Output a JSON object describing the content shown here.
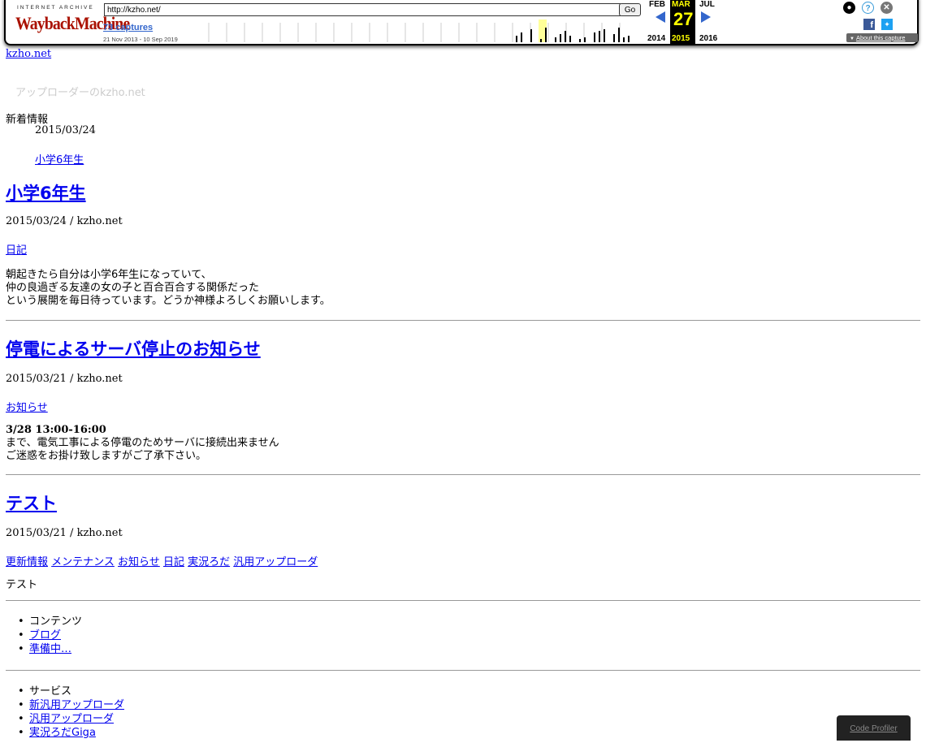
{
  "wayback": {
    "ia_text": "INTERNET ARCHIVE",
    "logo_text": "WaybackMachine",
    "url": "http://kzho.net/",
    "go_label": "Go",
    "captures_label": "73 captures",
    "capture_dates": "21 Nov 2013 - 10 Sep 2019",
    "prev_month": "FEB",
    "current_month": "MAR",
    "next_month": "JUL",
    "current_day": "27",
    "prev_year": "2014",
    "current_year": "2015",
    "next_year": "2016",
    "about_label": "About this capture",
    "user_icon": "person-icon",
    "help_glyph": "?",
    "close_glyph": "✕",
    "facebook_glyph": "f",
    "twitter_glyph": "t"
  },
  "site": {
    "top_link": "kzho.net",
    "tagline": "アップローダーのkzho.net",
    "news_heading": "新着情報",
    "news_date": "2015/03/24",
    "news_link": "小学6年生"
  },
  "posts": [
    {
      "title": "小学6年生",
      "meta": "2015/03/24 / kzho.net",
      "categories": [
        "日記"
      ],
      "body": [
        "朝起きたら自分は小学6年生になっていて、",
        "仲の良過ぎる友達の女の子と百合百合する関係だった",
        "という展開を毎日待っています。どうか神様よろしくお願いします。"
      ]
    },
    {
      "title": "停電によるサーバ停止のお知らせ",
      "meta": "2015/03/21 / kzho.net",
      "categories": [
        "お知らせ"
      ],
      "bold_line": "3/28 13:00-16:00",
      "body": [
        "まで、電気工事による停電のためサーバに接続出来ません",
        "ご迷惑をお掛け致しますがご了承下さい。"
      ]
    },
    {
      "title": "テスト",
      "meta": "2015/03/21 / kzho.net",
      "categories": [
        "更新情報",
        "メンテナンス",
        "お知らせ",
        "日記",
        "実況ろだ",
        "汎用アップローダ"
      ],
      "body": [
        "テスト"
      ]
    }
  ],
  "contents_menu": {
    "heading": "コンテンツ",
    "items": [
      "ブログ",
      "準備中…"
    ]
  },
  "services_menu": {
    "heading": "サービス",
    "items": [
      "新汎用アップローダ",
      "汎用アップローダ",
      "実況ろだGiga"
    ]
  },
  "code_profiler": "Code Profiler",
  "colors": {
    "link": "#0000ee",
    "wayback_blue": "#3366cc",
    "current_highlight": "#ffff00",
    "tagline": "#cccccc"
  }
}
